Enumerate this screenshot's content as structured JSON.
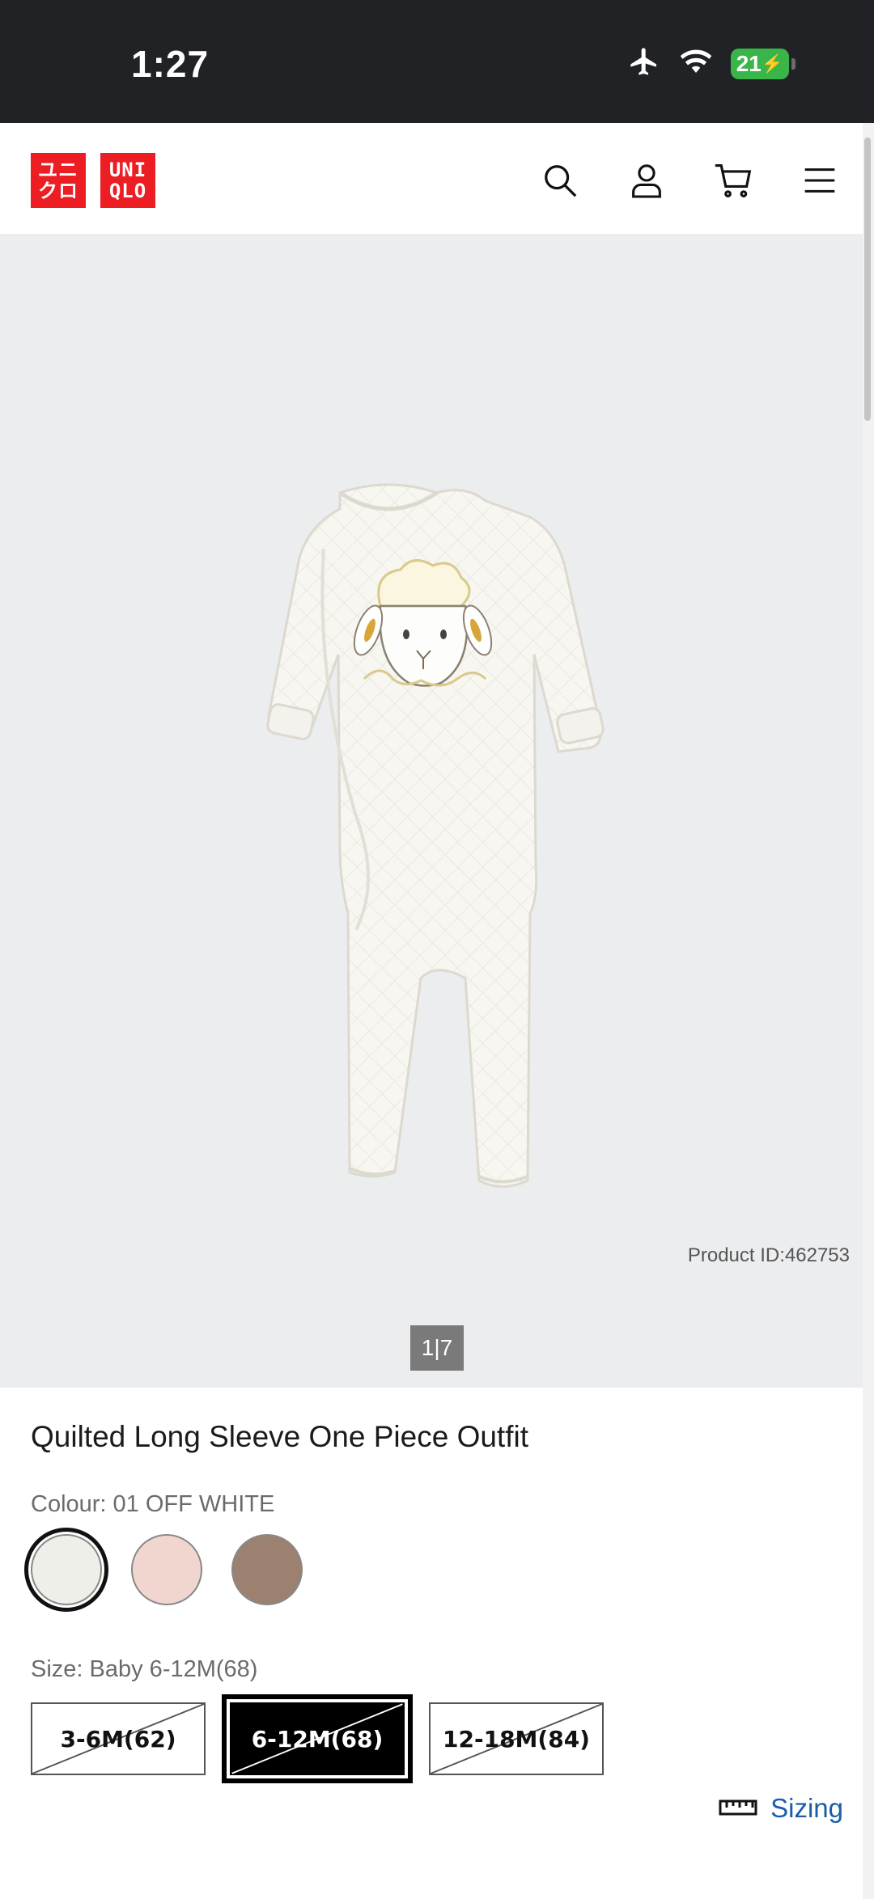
{
  "status_bar": {
    "time": "1:27",
    "battery": "21",
    "icons": [
      "airplane-icon",
      "wifi-icon",
      "battery-charging-icon"
    ]
  },
  "header": {
    "logo_left": [
      "ユニ",
      "クロ"
    ],
    "logo_right": [
      "UNI",
      "QLO"
    ],
    "icons": [
      "search-icon",
      "account-icon",
      "cart-icon",
      "menu-icon"
    ],
    "brand_color": "#ed1d24"
  },
  "gallery": {
    "product_id": "Product ID:462753",
    "pager": "1|7"
  },
  "product": {
    "title": "Quilted Long Sleeve One Piece Outfit",
    "colour_label": "Colour: 01 OFF WHITE",
    "colours": [
      {
        "name": "01 OFF WHITE",
        "hex": "#efefea",
        "selected": true
      },
      {
        "name": "pink",
        "hex": "#f0d6cf",
        "selected": false
      },
      {
        "name": "brown",
        "hex": "#9c8170",
        "selected": false
      }
    ],
    "size_label": "Size: Baby 6-12M(68)",
    "sizes": [
      {
        "label": "3-6M(62)",
        "selected": false
      },
      {
        "label": "6-12M(68)",
        "selected": true
      },
      {
        "label": "12-18M(84)",
        "selected": false
      }
    ],
    "sizing_link": "Sizing"
  }
}
